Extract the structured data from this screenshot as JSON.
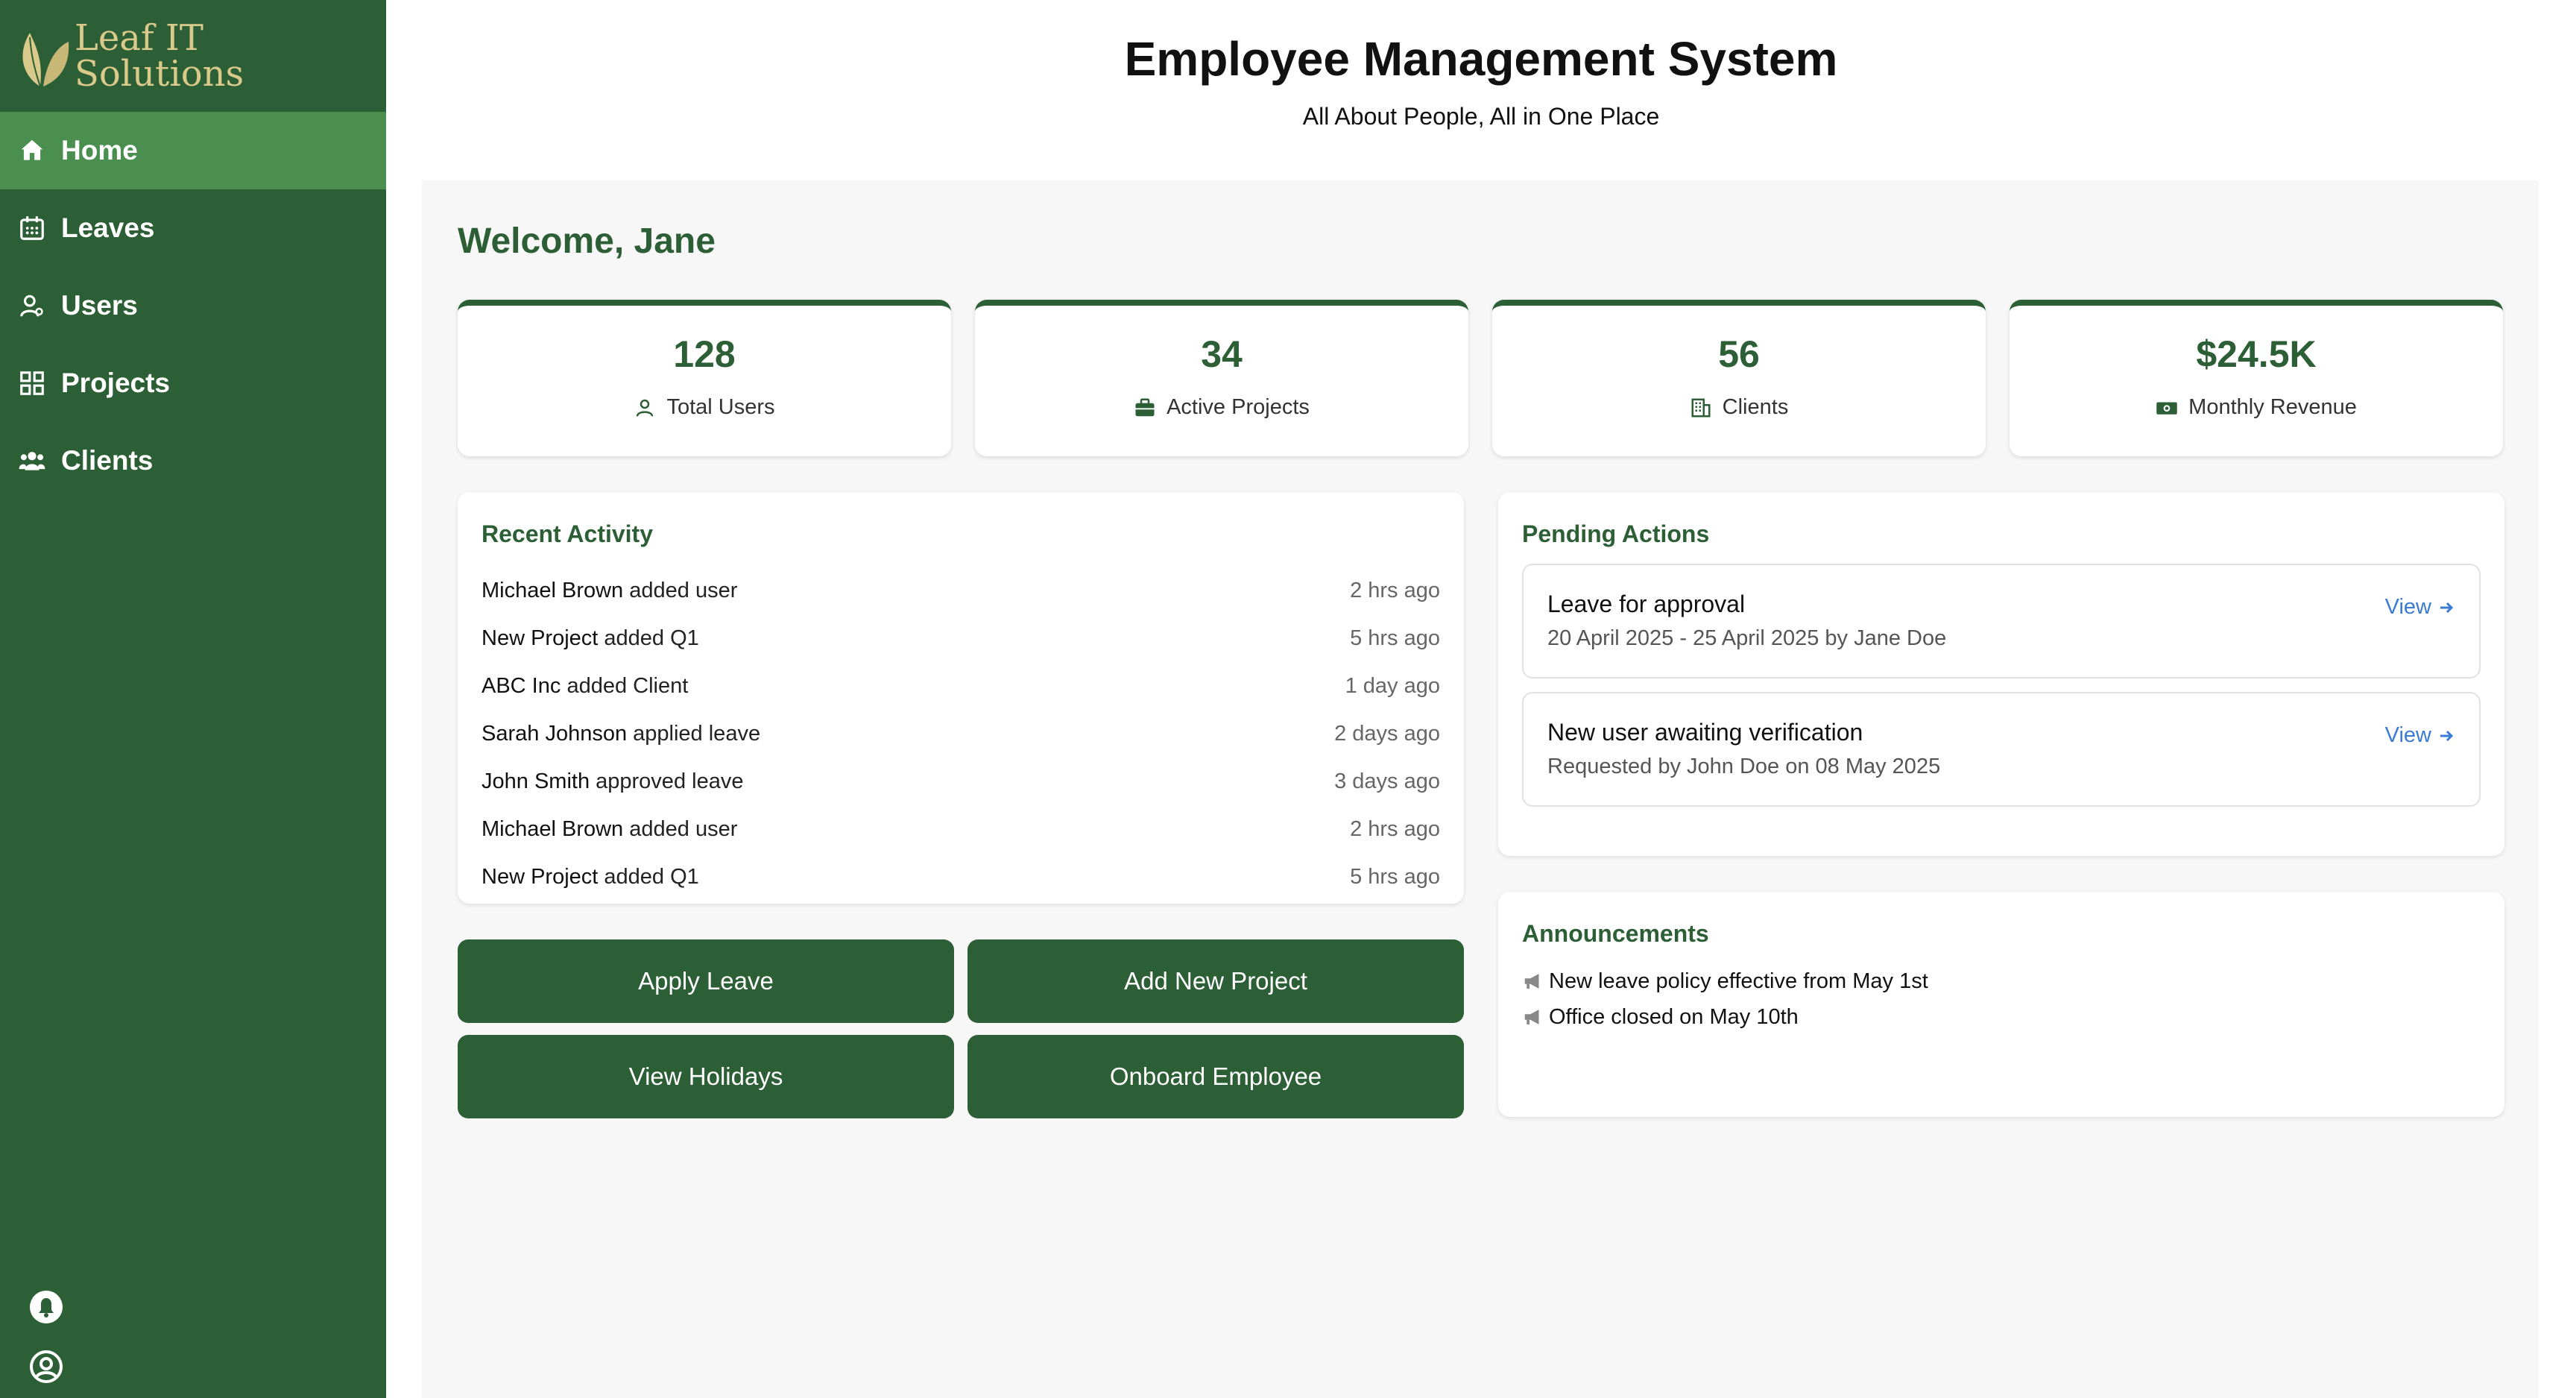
{
  "brand": {
    "line1": "Leaf IT",
    "line2": "Solutions"
  },
  "sidebar": {
    "items": [
      {
        "label": "Home",
        "icon": "home-icon",
        "active": true
      },
      {
        "label": "Leaves",
        "icon": "calendar-icon",
        "active": false
      },
      {
        "label": "Users",
        "icon": "user-icon",
        "active": false
      },
      {
        "label": "Projects",
        "icon": "grid-icon",
        "active": false
      },
      {
        "label": "Clients",
        "icon": "users-group-icon",
        "active": false
      }
    ],
    "bottom_icons": [
      "bell-icon",
      "user-circle-icon"
    ]
  },
  "header": {
    "title": "Employee Management System",
    "subtitle": "All About People, All in One Place"
  },
  "main": {
    "welcome": "Welcome, Jane",
    "stats": [
      {
        "value": "128",
        "label": "Total Users",
        "icon": "user-icon"
      },
      {
        "value": "34",
        "label": "Active Projects",
        "icon": "briefcase-icon"
      },
      {
        "value": "56",
        "label": "Clients",
        "icon": "building-icon"
      },
      {
        "value": "$24.5K",
        "label": "Monthly Revenue",
        "icon": "money-icon"
      }
    ],
    "recent_activity": {
      "title": "Recent Activity",
      "rows": [
        {
          "who": "Michael Brown",
          "what": "added user",
          "time": "2 hrs ago"
        },
        {
          "who": "New Project",
          "what": "added Q1",
          "time": "5 hrs ago"
        },
        {
          "who": "ABC Inc",
          "what": "added Client",
          "time": "1 day ago"
        },
        {
          "who": "Sarah Johnson",
          "what": "applied leave",
          "time": "2 days ago"
        },
        {
          "who": "John Smith",
          "what": "approved leave",
          "time": "3 days ago"
        },
        {
          "who": "Michael Brown",
          "what": "added user",
          "time": "2 hrs ago"
        },
        {
          "who": "New Project",
          "what": "added Q1",
          "time": "5 hrs ago"
        }
      ]
    },
    "actions": {
      "apply_leave": "Apply Leave",
      "add_project": "Add New Project",
      "view_holidays": "View Holidays",
      "onboard_employee": "Onboard Employee"
    },
    "pending": {
      "title": "Pending Actions",
      "items": [
        {
          "title": "Leave for approval",
          "sub": "20 April 2025 - 25 April 2025 by Jane Doe",
          "link": "View"
        },
        {
          "title": "New user awaiting verification",
          "sub": "Requested by John Doe on 08 May 2025",
          "link": "View"
        }
      ]
    },
    "announcements": {
      "title": "Announcements",
      "items": [
        "New leave policy effective from May 1st",
        "Office closed on May 10th"
      ]
    }
  },
  "colors": {
    "primary": "#2d5f36",
    "active_nav": "#4b8f50",
    "link": "#3a7bd5",
    "logo_gold": "#d9c98a"
  }
}
